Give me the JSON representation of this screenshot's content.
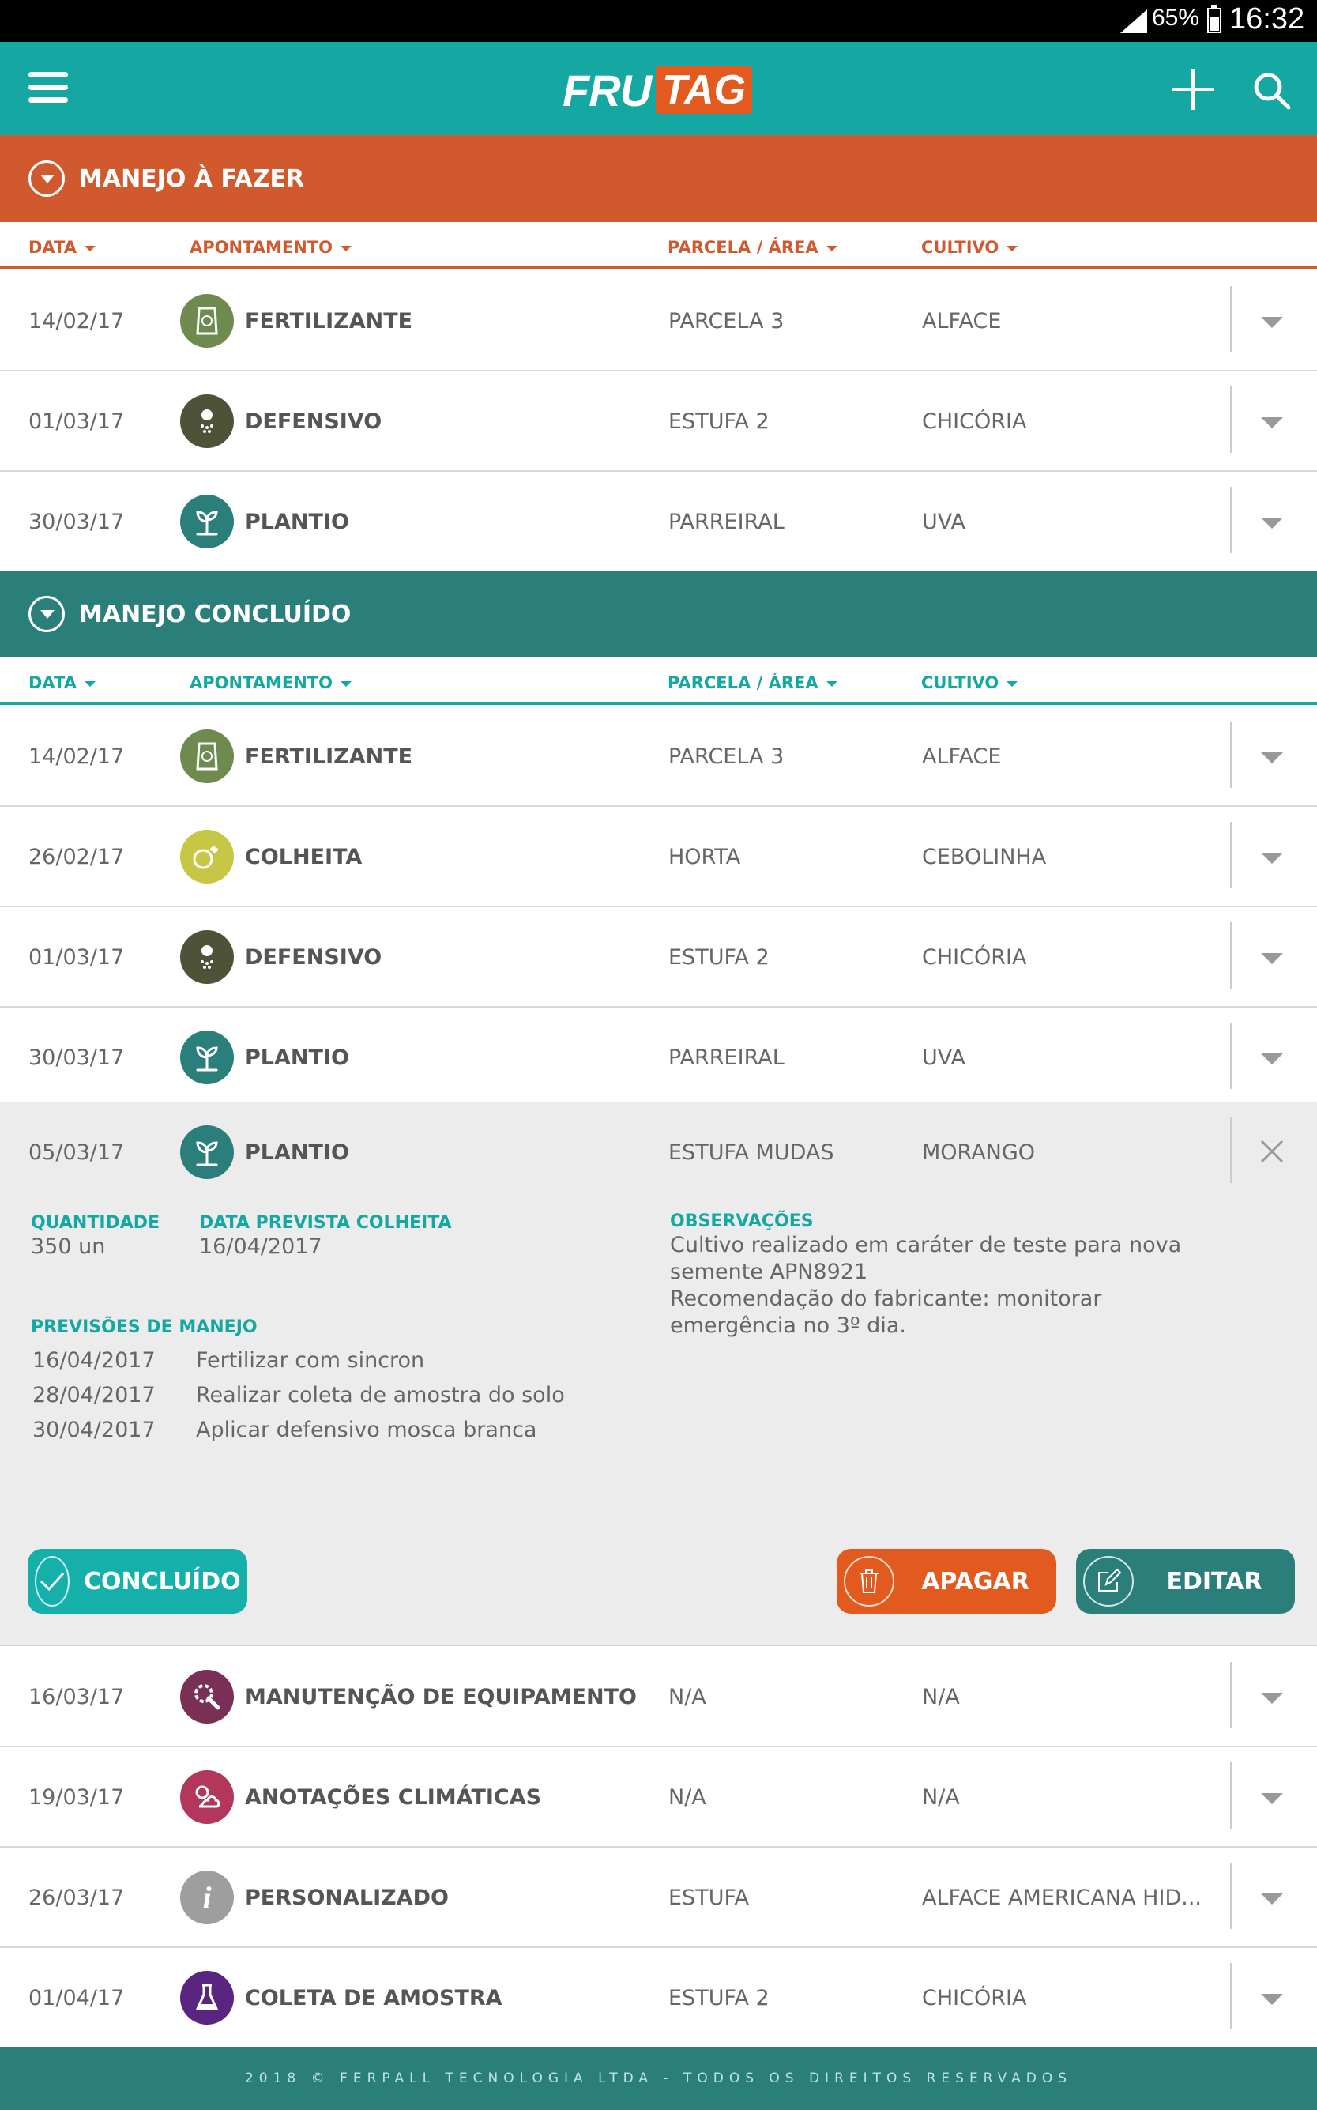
{
  "status": {
    "battery": "65%",
    "time": "16:32"
  },
  "app": {
    "logo_left": "FRU",
    "logo_right": "TAG"
  },
  "todo": {
    "title": "MANEJO À FAZER",
    "columns": [
      "DATA",
      "APONTAMENTO",
      "PARCELA / ÁREA",
      "CULTIVO"
    ],
    "rows": [
      {
        "date": "14/02/17",
        "type": "FERTILIZANTE",
        "icon": "fertilizer-icon",
        "area": "PARCELA 3",
        "crop": "ALFACE"
      },
      {
        "date": "01/03/17",
        "type": "DEFENSIVO",
        "icon": "pesticide-icon",
        "area": "ESTUFA 2",
        "crop": "CHICÓRIA"
      },
      {
        "date": "30/03/17",
        "type": "PLANTIO",
        "icon": "sprout-icon",
        "area": "PARREIRAL",
        "crop": "UVA"
      }
    ]
  },
  "done": {
    "title": "MANEJO CONCLUÍDO",
    "columns": [
      "DATA",
      "APONTAMENTO",
      "PARCELA / ÁREA",
      "CULTIVO"
    ],
    "rows": [
      {
        "date": "14/02/17",
        "type": "FERTILIZANTE",
        "icon": "fertilizer-icon",
        "area": "PARCELA 3",
        "crop": "ALFACE"
      },
      {
        "date": "26/02/17",
        "type": "COLHEITA",
        "icon": "harvest-icon",
        "area": "HORTA",
        "crop": "CEBOLINHA"
      },
      {
        "date": "01/03/17",
        "type": "DEFENSIVO",
        "icon": "pesticide-icon",
        "area": "ESTUFA 2",
        "crop": "CHICÓRIA"
      },
      {
        "date": "30/03/17",
        "type": "PLANTIO",
        "icon": "sprout-icon",
        "area": "PARREIRAL",
        "crop": "UVA"
      }
    ],
    "expanded": {
      "date": "05/03/17",
      "type": "PLANTIO",
      "icon": "sprout-icon",
      "area": "ESTUFA MUDAS",
      "crop": "MORANGO",
      "quantity_label": "QUANTIDADE",
      "quantity_value": "350 un",
      "harvest_label": "DATA PREVISTA COLHEITA",
      "harvest_value": "16/04/2017",
      "notes_label": "OBSERVAÇÕES",
      "notes_lines": [
        "Cultivo realizado em caráter de teste para nova",
        "semente APN8921",
        "Recomendação do fabricante: monitorar",
        "emergência no 3º dia."
      ],
      "forecast_label": "PREVISÕES DE MANEJO",
      "forecast": [
        {
          "date": "16/04/2017",
          "text": "Fertilizar com sincron"
        },
        {
          "date": "28/04/2017",
          "text": "Realizar coleta de amostra do solo"
        },
        {
          "date": "30/04/2017",
          "text": "Aplicar defensivo mosca branca"
        }
      ],
      "btn_done": "CONCLUÍDO",
      "btn_delete": "APAGAR",
      "btn_edit": "EDITAR"
    },
    "rows_after": [
      {
        "date": "16/03/17",
        "type": "MANUTENÇÃO DE EQUIPAMENTO",
        "icon": "maintenance-icon",
        "area": "N/A",
        "crop": "N/A"
      },
      {
        "date": "19/03/17",
        "type": "ANOTAÇÕES CLIMÁTICAS",
        "icon": "weather-icon",
        "area": "N/A",
        "crop": "N/A"
      },
      {
        "date": "26/03/17",
        "type": "PERSONALIZADO",
        "icon": "info-icon",
        "area": "ESTUFA",
        "crop": "ALFACE AMERICANA HID..."
      },
      {
        "date": "01/04/17",
        "type": "COLETA DE AMOSTRA",
        "icon": "flask-icon",
        "area": "ESTUFA 2",
        "crop": "CHICÓRIA"
      }
    ]
  },
  "footer": "2018 © FERPALL TECNOLOGIA LTDA - TODOS OS DIREITOS RESERVADOS",
  "colors": {
    "teal": "#15a8a2",
    "dark_teal": "#2a7f7b",
    "orange": "#d05a2e",
    "fertilizer": "#6e8a4e",
    "pesticide": "#4d5238",
    "sprout": "#2a7f7b",
    "harvest": "#c7c645",
    "maintenance": "#7a2f56",
    "weather": "#b3365b",
    "info": "#9e9e9e",
    "flask": "#5a2580"
  }
}
